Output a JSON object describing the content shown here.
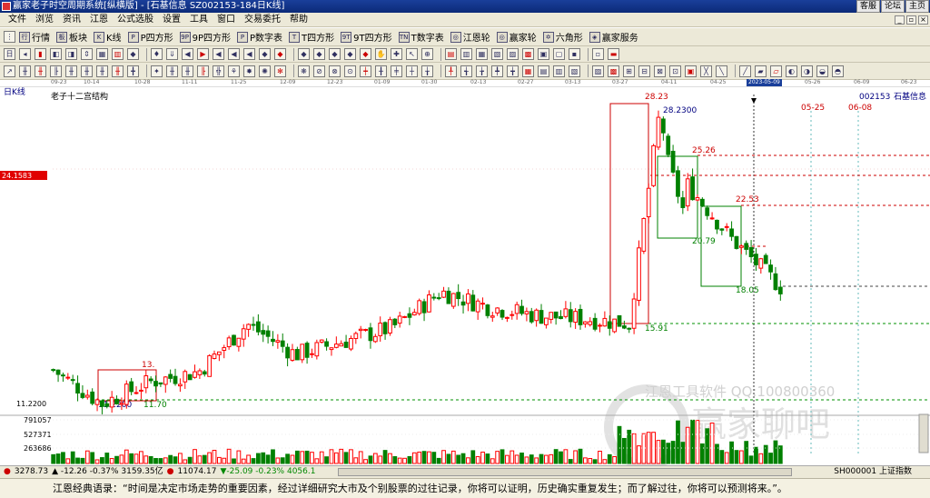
{
  "window": {
    "title": "赢家老子时空周期系统[纵横版] - [石基信息  SZ002153-184日K线]",
    "links": [
      "客服",
      "论坛",
      "主页"
    ]
  },
  "menu": [
    "文件",
    "浏览",
    "资讯",
    "江恩",
    "公式选股",
    "设置",
    "工具",
    "窗口",
    "交易委托",
    "帮助"
  ],
  "toolbar1": [
    {
      "icon": "行",
      "label": "行情"
    },
    {
      "icon": "板",
      "label": "板块"
    },
    {
      "icon": "K",
      "label": "K线"
    },
    {
      "icon": "P",
      "label": "P四方形"
    },
    {
      "icon": "9P",
      "label": "9P四方形"
    },
    {
      "icon": "P",
      "label": "P数字表"
    },
    {
      "icon": "T",
      "label": "T四方形"
    },
    {
      "icon": "9T",
      "label": "9T四方形"
    },
    {
      "icon": "TN",
      "label": "T数字表"
    },
    {
      "icon": "◎",
      "label": "江恩轮"
    },
    {
      "icon": "◎",
      "label": "赢家轮"
    },
    {
      "icon": "✡",
      "label": "六角形"
    },
    {
      "icon": "◈",
      "label": "赢家服务"
    }
  ],
  "toolbar2_icons": 38,
  "toolbar3_icons": 52,
  "header": {
    "period": "日K线",
    "indicator": "老子十二宫结构",
    "code": "002153",
    "name": "石基信息"
  },
  "axis": {
    "date_ticks": [
      "09-23",
      "10-14",
      "10-28",
      "11-11",
      "11-25",
      "12-09",
      "12-23",
      "01-09",
      "01-30",
      "02-13",
      "02-27",
      "03-13",
      "03-27",
      "04-11",
      "04-25",
      "2023-05-09",
      "05-26",
      "06-09",
      "06-23"
    ],
    "price_marker": "24.1583",
    "low_price": "11.2200",
    "volume_ticks": [
      "791057",
      "527371",
      "263686"
    ]
  },
  "annotations": {
    "high": "28.23",
    "high_dash": "28.2300",
    "p2526": "25.26",
    "p2253": "22.53",
    "p2079": "20.79",
    "p1805": "18.05",
    "p1591": "15.91",
    "p13": "13.",
    "low_dash": "11.2200",
    "p1170": "11.70",
    "date1": "05-25",
    "date2": "06-08"
  },
  "watermark": {
    "line1": "江恩工具软件 QQ:100800360",
    "line2": "赢家聊吧"
  },
  "status": {
    "sh": "3278.73",
    "sh_chg": "▲ -12.26 -0.37% 3159.35亿",
    "sz": "11074.17",
    "sz_chg": "▼-25.09 -0.23% 4056.1",
    "index": "SH000001 上证指数"
  },
  "quote": "江恩经典语录：“时间是决定市场走势的重要因素，经过详细研究大市及个别股票的过往记录，你将可以证明，历史确实重复发生；而了解过往，你将可以预测将来。”。",
  "chart_data": {
    "type": "candlestick",
    "dates": [
      "09-23",
      "10-14",
      "10-28",
      "11-11",
      "11-25",
      "12-09",
      "12-23",
      "01-09",
      "01-30",
      "02-13",
      "02-27",
      "03-13",
      "03-27",
      "04-11",
      "04-25",
      "05-09"
    ],
    "close": [
      13.3,
      11.3,
      12.6,
      13.2,
      16.0,
      14.2,
      15.0,
      15.8,
      17.9,
      17.0,
      16.5,
      16.3,
      16.0,
      24.5,
      21.0,
      18.2
    ],
    "ylim": [
      11.0,
      29.0
    ],
    "high": 28.23,
    "low": 11.22,
    "colors": {
      "up": "#ff0000",
      "down": "#008000",
      "box": "#cc0000",
      "dash_red": "#cc0000",
      "dash_green": "#009000"
    }
  }
}
